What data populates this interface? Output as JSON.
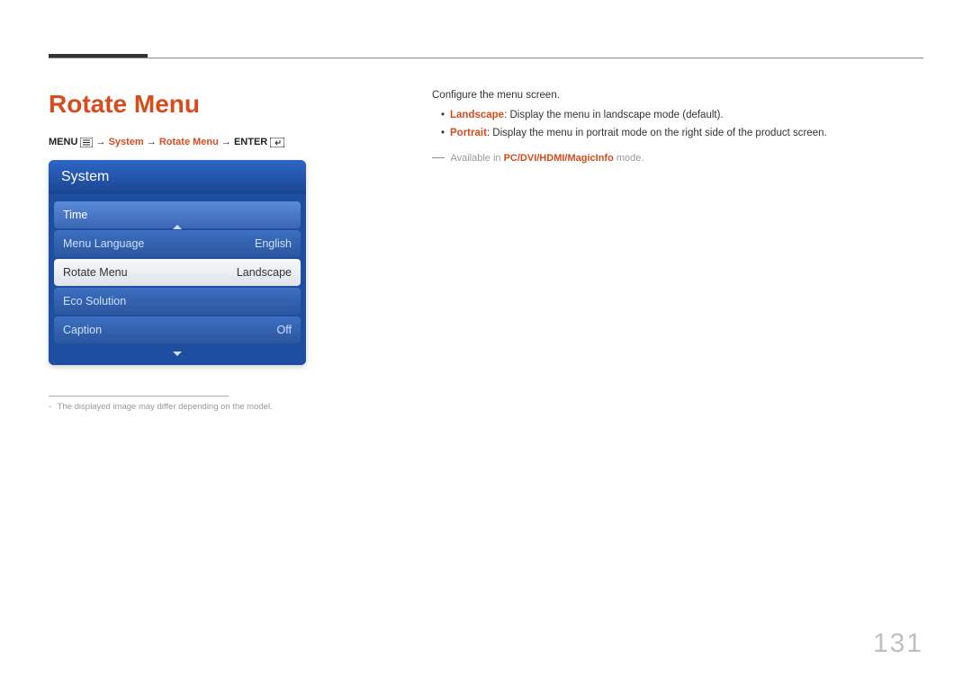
{
  "heading": "Rotate Menu",
  "breadcrumb": {
    "menu_label": "MENU",
    "arrow": "→",
    "path1": "System",
    "path2": "Rotate Menu",
    "enter_label": "ENTER"
  },
  "panel": {
    "title": "System",
    "rows": [
      {
        "label": "Time",
        "value": "",
        "state": "hover"
      },
      {
        "label": "Menu Language",
        "value": "English",
        "state": "plain"
      },
      {
        "label": "Rotate Menu",
        "value": "Landscape",
        "state": "selected"
      },
      {
        "label": "Eco Solution",
        "value": "",
        "state": "plain"
      },
      {
        "label": "Caption",
        "value": "Off",
        "state": "plain"
      }
    ]
  },
  "footnote": {
    "text": "The displayed image may differ depending on the model."
  },
  "description": {
    "intro": "Configure the menu screen.",
    "bullets": [
      {
        "term": "Landscape",
        "text": ": Display the menu in landscape mode (default)."
      },
      {
        "term": "Portrait",
        "text": ": Display the menu in portrait mode on the right side of the product screen."
      }
    ],
    "availability_prefix": "Available in ",
    "availability_modes": "PC/DVI/HDMI/MagicInfo",
    "availability_suffix": " mode."
  },
  "page_number": "131"
}
